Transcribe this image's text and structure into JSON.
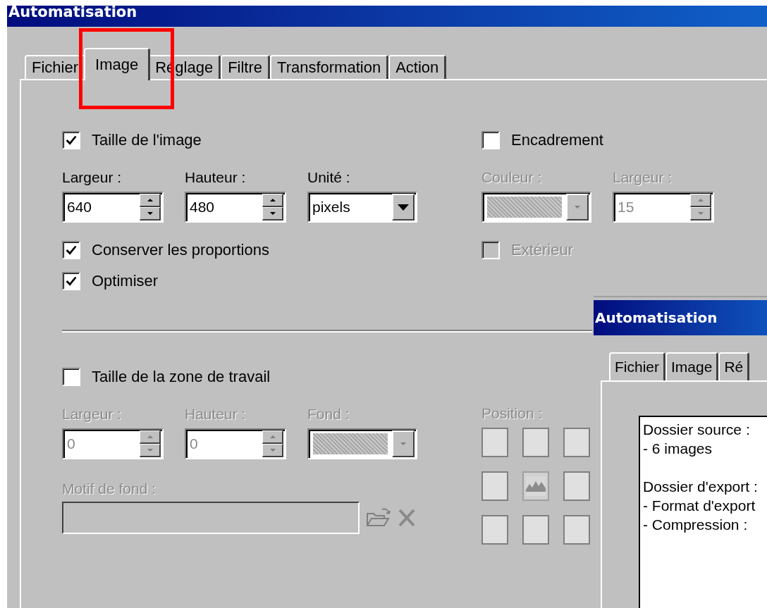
{
  "window": {
    "title": "Automatisation"
  },
  "tabs": [
    {
      "label": "Fichier",
      "selected": false
    },
    {
      "label": "Image",
      "selected": true
    },
    {
      "label": "Réglage",
      "selected": false
    },
    {
      "label": "Filtre",
      "selected": false
    },
    {
      "label": "Transformation",
      "selected": false
    },
    {
      "label": "Action",
      "selected": false
    }
  ],
  "image_size": {
    "label": "Taille de l'image",
    "checked": true,
    "fields": [
      {
        "kind": "spin",
        "label": "Largeur :",
        "value": "640",
        "disabled": false
      },
      {
        "kind": "spin",
        "label": "Hauteur :",
        "value": "480",
        "disabled": false
      },
      {
        "kind": "dropdown",
        "label": "Unité :",
        "value": "pixels",
        "disabled": false
      }
    ],
    "options": [
      {
        "label": "Conserver les proportions",
        "checked": true,
        "disabled": false
      },
      {
        "label": "Optimiser",
        "checked": true,
        "disabled": false
      }
    ]
  },
  "frame": {
    "label": "Encadrement",
    "checked": false,
    "fields": [
      {
        "kind": "color",
        "label": "Couleur :",
        "disabled": true
      },
      {
        "kind": "spin",
        "label": "Largeur :",
        "value": "15",
        "disabled": true
      }
    ],
    "options": [
      {
        "label": "Extérieur",
        "checked": false,
        "disabled": true
      }
    ]
  },
  "canvas_size": {
    "label": "Taille de la zone de travail",
    "checked": false,
    "fields": [
      {
        "kind": "spin",
        "label": "Largeur :",
        "value": "0",
        "disabled": true
      },
      {
        "kind": "spin",
        "label": "Hauteur :",
        "value": "0",
        "disabled": true
      },
      {
        "kind": "color",
        "label": "Fond :",
        "disabled": true
      }
    ],
    "pattern": {
      "label": "Motif de fond :",
      "disabled": true
    }
  },
  "position": {
    "label": "Position :",
    "disabled": true,
    "cells": [
      {
        "selected": false
      },
      {
        "selected": false
      },
      {
        "selected": false
      },
      {
        "selected": false
      },
      {
        "selected": true
      },
      {
        "selected": false
      },
      {
        "selected": false
      },
      {
        "selected": false
      },
      {
        "selected": false
      }
    ]
  },
  "second_window": {
    "title": "Automatisation",
    "tabs": [
      {
        "label": "Fichier",
        "selected": false
      },
      {
        "label": "Image",
        "selected": false
      },
      {
        "label": "Ré",
        "selected": false
      }
    ],
    "summary_blocks": [
      [
        "Dossier source :",
        "- 6 images"
      ],
      [
        "Dossier d'export :",
        "- Format d'export",
        "- Compression :"
      ]
    ]
  }
}
